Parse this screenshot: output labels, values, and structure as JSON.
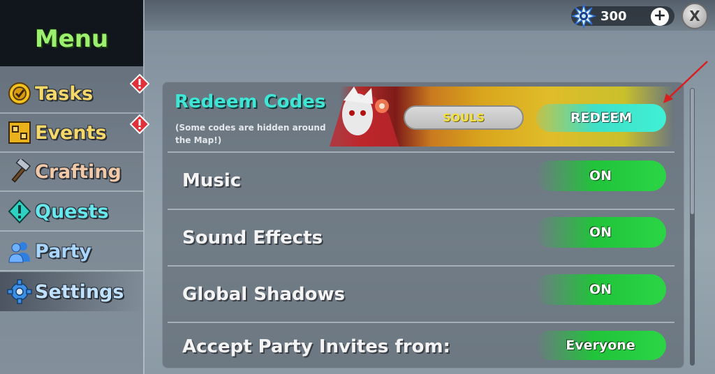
{
  "header": {
    "souls_count": "300",
    "add_label": "+",
    "close_label": "X"
  },
  "sidebar": {
    "title": "Menu",
    "items": [
      {
        "label": "Tasks",
        "icon": "tasks-icon",
        "alert": true
      },
      {
        "label": "Events",
        "icon": "events-icon",
        "alert": true
      },
      {
        "label": "Crafting",
        "icon": "hammer-icon",
        "alert": false
      },
      {
        "label": "Quests",
        "icon": "quests-icon",
        "alert": false
      },
      {
        "label": "Party",
        "icon": "party-icon",
        "alert": false
      },
      {
        "label": "Settings",
        "icon": "gear-icon",
        "alert": false,
        "active": true
      }
    ]
  },
  "redeem": {
    "title": "Redeem Codes",
    "note": "(Some codes are hidden around the Map!)",
    "input_value": "SOULS",
    "button_label": "REDEEM"
  },
  "settings": [
    {
      "label": "Music",
      "value": "ON"
    },
    {
      "label": "Sound Effects",
      "value": "ON"
    },
    {
      "label": "Global Shadows",
      "value": "ON"
    },
    {
      "label": "Accept Party Invites from:",
      "value": "Everyone"
    }
  ],
  "colors": {
    "menu_title": "#9df06f",
    "redeem_title": "#3fe6d6",
    "toggle_on": "#2bd546",
    "redeem_button": "#3ff0d6",
    "alert": "#e0303a"
  }
}
